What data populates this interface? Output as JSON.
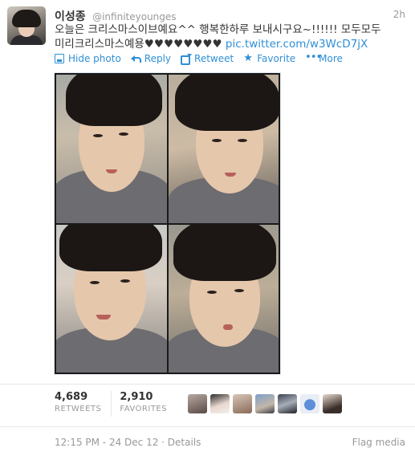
{
  "tweet": {
    "fullname": "이성종",
    "username": "@infiniteyounges",
    "time": "2h",
    "text_line1": "오늘은 크리스마스이브예요^^ 행복한하루 보내시구요~!!!!!! 모두모두",
    "text_line2_prefix": "미리크리스마스예용♥♥♥♥♥♥♥♥ ",
    "link": "pic.twitter.com/w3WcD7jX"
  },
  "actions": {
    "hide_photo": "Hide photo",
    "reply": "Reply",
    "retweet": "Retweet",
    "favorite": "Favorite",
    "more": "More"
  },
  "icons": {
    "hide_photo": "photo-icon",
    "reply": "reply-icon",
    "retweet": "retweet-icon",
    "favorite": "star-icon",
    "more": "more-dots-icon"
  },
  "stats": {
    "retweets_count": "4,689",
    "retweets_label": "RETWEETS",
    "favorites_count": "2,910",
    "favorites_label": "FAVORITES"
  },
  "footer": {
    "timestamp": "12:15 PM - 24 Dec 12",
    "separator": " · ",
    "details": "Details",
    "flag_media": "Flag media"
  },
  "colors": {
    "link": "#2f8fd6",
    "muted": "#999999",
    "text": "#333333"
  }
}
